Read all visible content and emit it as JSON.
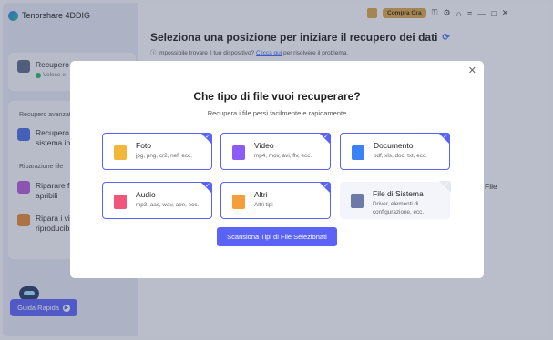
{
  "app": {
    "title": "Tenorshare 4DDIG",
    "buy_label": "Compra Ora"
  },
  "sidebar": {
    "recover": {
      "title": "Recupero dati",
      "status": "Veloce e"
    },
    "section_advanced": "Recupero avanzato",
    "advanced_item": {
      "title": "Recupero",
      "line2": "sistema in"
    },
    "section_repair": "Riparazione file",
    "repair_items": [
      {
        "title": "Riparare f",
        "line2": "apribili"
      },
      {
        "title": "Ripara i vi",
        "line2": "riproducib"
      }
    ],
    "guide_label": "Guida Rapida"
  },
  "main": {
    "title": "Seleziona una posizione per iniziare il recupero dei dati",
    "subtitle_text": "Impossibile trovare il tuo dispositivo?",
    "subtitle_link": "Clicca qui",
    "subtitle_rest": "per risolvere il problema.",
    "right_file": "File"
  },
  "modal": {
    "title": "Che tipo di file vuoi recuperare?",
    "subtitle": "Recupera i file persi facilmente e rapidamente",
    "scan_button": "Scansiona Tipi di File Selezionati",
    "cards": [
      {
        "title": "Foto",
        "desc": "jpg, png, cr2, nef, ecc.",
        "icon": "image-icon",
        "color": "#f2b73a",
        "checked": true
      },
      {
        "title": "Video",
        "desc": "mp4, mov, avi, flv, ecc.",
        "icon": "video-icon",
        "color": "#8b5cf6",
        "checked": true
      },
      {
        "title": "Documento",
        "desc": "pdf, xls, doc, txt, ecc.",
        "icon": "document-icon",
        "color": "#3b82f6",
        "checked": true
      },
      {
        "title": "Audio",
        "desc": "mp3, aac, wav, ape, ecc.",
        "icon": "music-icon",
        "color": "#f0567a",
        "checked": true
      },
      {
        "title": "Altri",
        "desc": "Altri tipi",
        "icon": "other-files-icon",
        "color": "#f59e3a",
        "checked": true
      },
      {
        "title": "File di Sistema",
        "desc": "Driver, elementi di configurazione, ecc.",
        "icon": "system-file-icon",
        "color": "#6b7aa6",
        "checked": false
      }
    ]
  }
}
